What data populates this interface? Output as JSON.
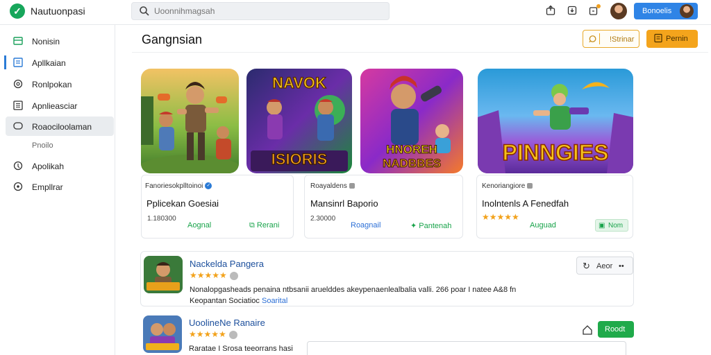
{
  "app": {
    "name": "Nautuonpasi"
  },
  "search": {
    "placeholder": "Uoonnihmagsah"
  },
  "topbar": {
    "button_label": "Bonoelis"
  },
  "sidebar": {
    "items": [
      {
        "label": "Nonisin",
        "icon": "grid-icon"
      },
      {
        "label": "Apllkaian",
        "icon": "apps-icon"
      },
      {
        "label": "Ronlpokan",
        "icon": "circle-icon"
      },
      {
        "label": "Apnlieasciar",
        "icon": "list-icon"
      },
      {
        "label": "Roaociloolaman",
        "icon": "chat-icon"
      },
      {
        "label": "Pnoilo",
        "icon": ""
      },
      {
        "label": "Apolikah",
        "icon": "pin-icon"
      },
      {
        "label": "Empllrar",
        "icon": "settings-icon"
      }
    ]
  },
  "main": {
    "title": "Gangnsian",
    "header_buttons": {
      "outline_label": "!Strinar",
      "solid_label": "Pernin"
    }
  },
  "tiles": [
    {
      "name": "hero-tile"
    },
    {
      "name": "navok-tile",
      "text_top": "NAVOK",
      "text_bottom": "ISIORIS"
    },
    {
      "name": "hnorem-tile",
      "text_top": "HNOREH",
      "text_bottom": "NADBBES"
    },
    {
      "name": "pinngies-tile",
      "text": "PINNGIES"
    }
  ],
  "cards": [
    {
      "developer": "Fanoriesokplltoinoi",
      "title": "Pplicekan Goesiai",
      "meta": "1.180300",
      "action1": "Aognal",
      "action2": "Rerani"
    },
    {
      "developer": "Roayaldens",
      "title": "Mansinrl Baporio",
      "meta": "2.30000",
      "action1": "Roagnail",
      "action2": "Pantenah"
    },
    {
      "developer": "Kenoriangiore",
      "title": "Inolntenls A Fenedfah",
      "stars": "★★★★★",
      "action1": "Auguad",
      "action2": "Nom"
    }
  ],
  "list": [
    {
      "title": "Nackelda Pangera",
      "stars": "★★★★★",
      "desc1": "Nonalopgasheads penaina ntbsanii aruelddes akeypenaenlealbalia valli. 266 poar I natee A&8 fn",
      "desc2": "Keopantan Sociatioc",
      "link": "Soarital",
      "btn_label": "Aeor",
      "more": "••"
    },
    {
      "title": "UoolineNe Ranaire",
      "stars": "★★★★★",
      "desc1": "Raratae I Srosa teeorrans hasi",
      "btn_label": "Roodt"
    }
  ],
  "colors": {
    "accent": "#2f84e6",
    "green": "#18a34a",
    "orange": "#f4a41c",
    "star": "#f2a21b"
  }
}
